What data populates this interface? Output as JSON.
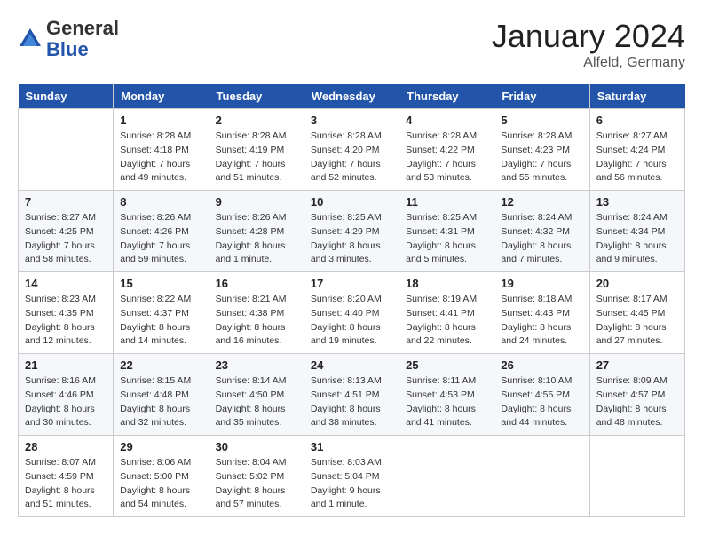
{
  "header": {
    "logo_general": "General",
    "logo_blue": "Blue",
    "month_title": "January 2024",
    "location": "Alfeld, Germany"
  },
  "days_of_week": [
    "Sunday",
    "Monday",
    "Tuesday",
    "Wednesday",
    "Thursday",
    "Friday",
    "Saturday"
  ],
  "weeks": [
    [
      {
        "day": "",
        "sunrise": "",
        "sunset": "",
        "daylight": ""
      },
      {
        "day": "1",
        "sunrise": "Sunrise: 8:28 AM",
        "sunset": "Sunset: 4:18 PM",
        "daylight": "Daylight: 7 hours and 49 minutes."
      },
      {
        "day": "2",
        "sunrise": "Sunrise: 8:28 AM",
        "sunset": "Sunset: 4:19 PM",
        "daylight": "Daylight: 7 hours and 51 minutes."
      },
      {
        "day": "3",
        "sunrise": "Sunrise: 8:28 AM",
        "sunset": "Sunset: 4:20 PM",
        "daylight": "Daylight: 7 hours and 52 minutes."
      },
      {
        "day": "4",
        "sunrise": "Sunrise: 8:28 AM",
        "sunset": "Sunset: 4:22 PM",
        "daylight": "Daylight: 7 hours and 53 minutes."
      },
      {
        "day": "5",
        "sunrise": "Sunrise: 8:28 AM",
        "sunset": "Sunset: 4:23 PM",
        "daylight": "Daylight: 7 hours and 55 minutes."
      },
      {
        "day": "6",
        "sunrise": "Sunrise: 8:27 AM",
        "sunset": "Sunset: 4:24 PM",
        "daylight": "Daylight: 7 hours and 56 minutes."
      }
    ],
    [
      {
        "day": "7",
        "sunrise": "Sunrise: 8:27 AM",
        "sunset": "Sunset: 4:25 PM",
        "daylight": "Daylight: 7 hours and 58 minutes."
      },
      {
        "day": "8",
        "sunrise": "Sunrise: 8:26 AM",
        "sunset": "Sunset: 4:26 PM",
        "daylight": "Daylight: 7 hours and 59 minutes."
      },
      {
        "day": "9",
        "sunrise": "Sunrise: 8:26 AM",
        "sunset": "Sunset: 4:28 PM",
        "daylight": "Daylight: 8 hours and 1 minute."
      },
      {
        "day": "10",
        "sunrise": "Sunrise: 8:25 AM",
        "sunset": "Sunset: 4:29 PM",
        "daylight": "Daylight: 8 hours and 3 minutes."
      },
      {
        "day": "11",
        "sunrise": "Sunrise: 8:25 AM",
        "sunset": "Sunset: 4:31 PM",
        "daylight": "Daylight: 8 hours and 5 minutes."
      },
      {
        "day": "12",
        "sunrise": "Sunrise: 8:24 AM",
        "sunset": "Sunset: 4:32 PM",
        "daylight": "Daylight: 8 hours and 7 minutes."
      },
      {
        "day": "13",
        "sunrise": "Sunrise: 8:24 AM",
        "sunset": "Sunset: 4:34 PM",
        "daylight": "Daylight: 8 hours and 9 minutes."
      }
    ],
    [
      {
        "day": "14",
        "sunrise": "Sunrise: 8:23 AM",
        "sunset": "Sunset: 4:35 PM",
        "daylight": "Daylight: 8 hours and 12 minutes."
      },
      {
        "day": "15",
        "sunrise": "Sunrise: 8:22 AM",
        "sunset": "Sunset: 4:37 PM",
        "daylight": "Daylight: 8 hours and 14 minutes."
      },
      {
        "day": "16",
        "sunrise": "Sunrise: 8:21 AM",
        "sunset": "Sunset: 4:38 PM",
        "daylight": "Daylight: 8 hours and 16 minutes."
      },
      {
        "day": "17",
        "sunrise": "Sunrise: 8:20 AM",
        "sunset": "Sunset: 4:40 PM",
        "daylight": "Daylight: 8 hours and 19 minutes."
      },
      {
        "day": "18",
        "sunrise": "Sunrise: 8:19 AM",
        "sunset": "Sunset: 4:41 PM",
        "daylight": "Daylight: 8 hours and 22 minutes."
      },
      {
        "day": "19",
        "sunrise": "Sunrise: 8:18 AM",
        "sunset": "Sunset: 4:43 PM",
        "daylight": "Daylight: 8 hours and 24 minutes."
      },
      {
        "day": "20",
        "sunrise": "Sunrise: 8:17 AM",
        "sunset": "Sunset: 4:45 PM",
        "daylight": "Daylight: 8 hours and 27 minutes."
      }
    ],
    [
      {
        "day": "21",
        "sunrise": "Sunrise: 8:16 AM",
        "sunset": "Sunset: 4:46 PM",
        "daylight": "Daylight: 8 hours and 30 minutes."
      },
      {
        "day": "22",
        "sunrise": "Sunrise: 8:15 AM",
        "sunset": "Sunset: 4:48 PM",
        "daylight": "Daylight: 8 hours and 32 minutes."
      },
      {
        "day": "23",
        "sunrise": "Sunrise: 8:14 AM",
        "sunset": "Sunset: 4:50 PM",
        "daylight": "Daylight: 8 hours and 35 minutes."
      },
      {
        "day": "24",
        "sunrise": "Sunrise: 8:13 AM",
        "sunset": "Sunset: 4:51 PM",
        "daylight": "Daylight: 8 hours and 38 minutes."
      },
      {
        "day": "25",
        "sunrise": "Sunrise: 8:11 AM",
        "sunset": "Sunset: 4:53 PM",
        "daylight": "Daylight: 8 hours and 41 minutes."
      },
      {
        "day": "26",
        "sunrise": "Sunrise: 8:10 AM",
        "sunset": "Sunset: 4:55 PM",
        "daylight": "Daylight: 8 hours and 44 minutes."
      },
      {
        "day": "27",
        "sunrise": "Sunrise: 8:09 AM",
        "sunset": "Sunset: 4:57 PM",
        "daylight": "Daylight: 8 hours and 48 minutes."
      }
    ],
    [
      {
        "day": "28",
        "sunrise": "Sunrise: 8:07 AM",
        "sunset": "Sunset: 4:59 PM",
        "daylight": "Daylight: 8 hours and 51 minutes."
      },
      {
        "day": "29",
        "sunrise": "Sunrise: 8:06 AM",
        "sunset": "Sunset: 5:00 PM",
        "daylight": "Daylight: 8 hours and 54 minutes."
      },
      {
        "day": "30",
        "sunrise": "Sunrise: 8:04 AM",
        "sunset": "Sunset: 5:02 PM",
        "daylight": "Daylight: 8 hours and 57 minutes."
      },
      {
        "day": "31",
        "sunrise": "Sunrise: 8:03 AM",
        "sunset": "Sunset: 5:04 PM",
        "daylight": "Daylight: 9 hours and 1 minute."
      },
      {
        "day": "",
        "sunrise": "",
        "sunset": "",
        "daylight": ""
      },
      {
        "day": "",
        "sunrise": "",
        "sunset": "",
        "daylight": ""
      },
      {
        "day": "",
        "sunrise": "",
        "sunset": "",
        "daylight": ""
      }
    ]
  ]
}
